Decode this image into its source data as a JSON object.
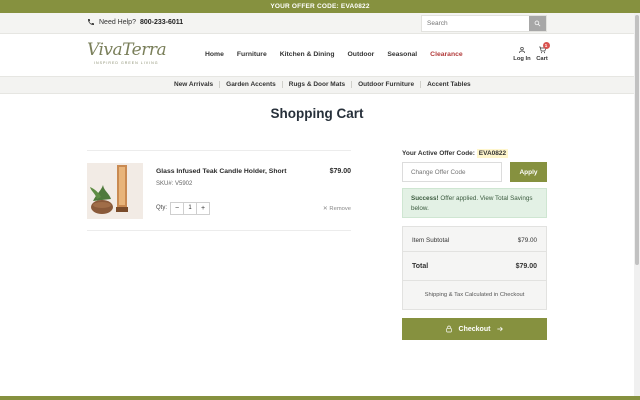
{
  "promo": {
    "text": "YOUR OFFER CODE: EVA0822"
  },
  "util": {
    "help_label": "Need Help?",
    "phone": "800-233-6011",
    "search_placeholder": "Search"
  },
  "logo": {
    "name": "VivaTerra",
    "tagline": "INSPIRED GREEN LIVING"
  },
  "nav": {
    "items": [
      "Home",
      "Furniture",
      "Kitchen & Dining",
      "Outdoor",
      "Seasonal"
    ],
    "clearance": "Clearance",
    "login": "Log In",
    "cart": "Cart",
    "cart_count": "1"
  },
  "subnav": {
    "items": [
      "New Arrivals",
      "Garden Accents",
      "Rugs & Door Mats",
      "Outdoor Furniture",
      "Accent Tables"
    ]
  },
  "page": {
    "title": "Shopping Cart"
  },
  "cart_item": {
    "name": "Glass Infused Teak Candle Holder, Short",
    "sku": "SKU#: V5902",
    "price": "$79.00",
    "qty_label": "Qty:",
    "qty": "1",
    "remove": "Remove"
  },
  "offer": {
    "label": "Your Active Offer Code:",
    "code": "EVA0822",
    "input_placeholder": "Change Offer Code",
    "apply": "Apply",
    "success_bold": "Success!",
    "success_text": " Offer applied. View Total Savings below."
  },
  "summary": {
    "subtotal_label": "Item Subtotal",
    "subtotal": "$79.00",
    "total_label": "Total",
    "total": "$79.00",
    "note": "Shipping & Tax Calculated in Checkout"
  },
  "checkout": {
    "label": "Checkout"
  },
  "colors": {
    "brand": "#86913f",
    "clearance": "#b23b3b",
    "success_bg": "#e3f1e5"
  }
}
